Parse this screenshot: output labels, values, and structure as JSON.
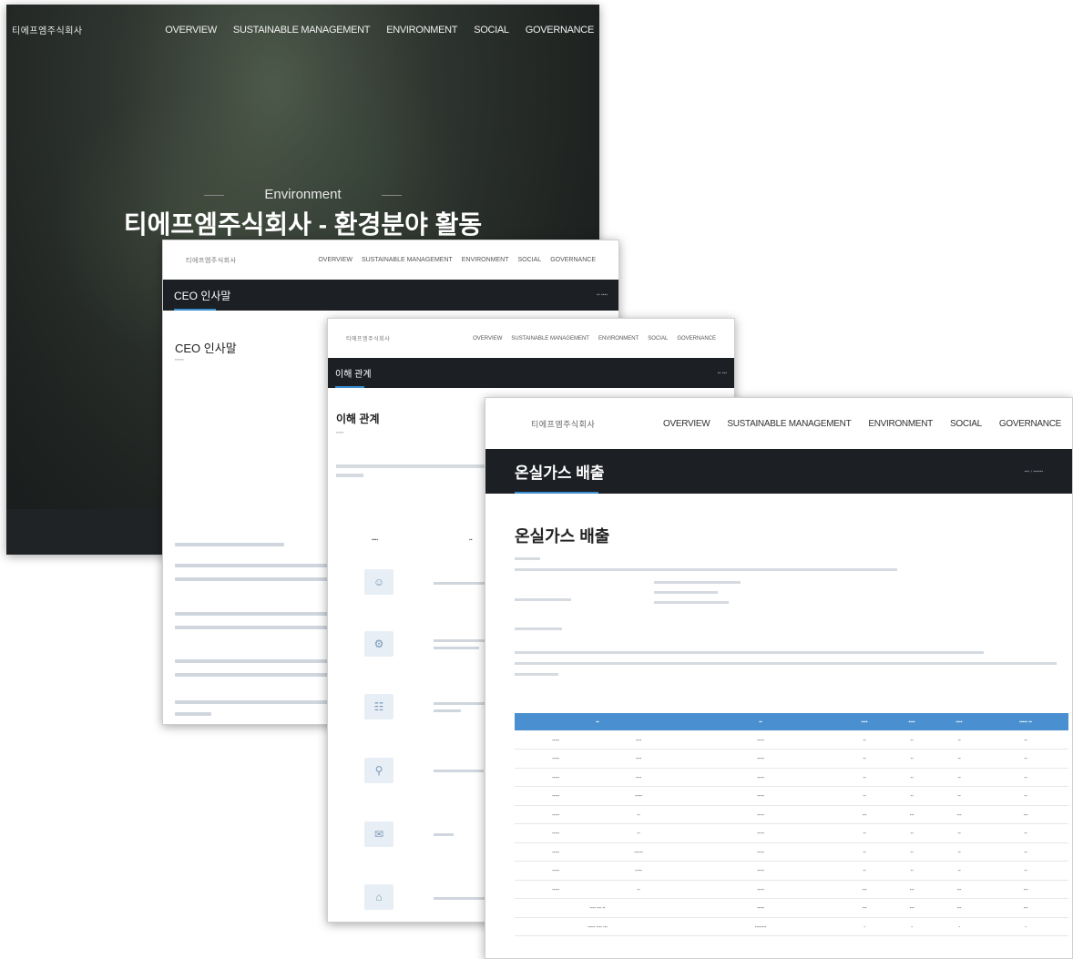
{
  "nav": {
    "logo": "티에프엠주식회사",
    "menu": [
      "OVERVIEW",
      "SUSTAINABLE MANAGEMENT",
      "ENVIRONMENT",
      "SOCIAL",
      "GOVERNANCE"
    ]
  },
  "hero": {
    "subtitle": "Environment",
    "title": "티에프엠주식회사 - 환경분야 활동"
  },
  "ceo": {
    "bar_title": "CEO 인사말",
    "section_title": "CEO 인사말"
  },
  "stakeholder": {
    "bar_title": "이해 관계",
    "section_title": "이해 관계"
  },
  "ghg": {
    "bar_title": "온실가스 배출",
    "section_title": "온실가스 배출"
  }
}
